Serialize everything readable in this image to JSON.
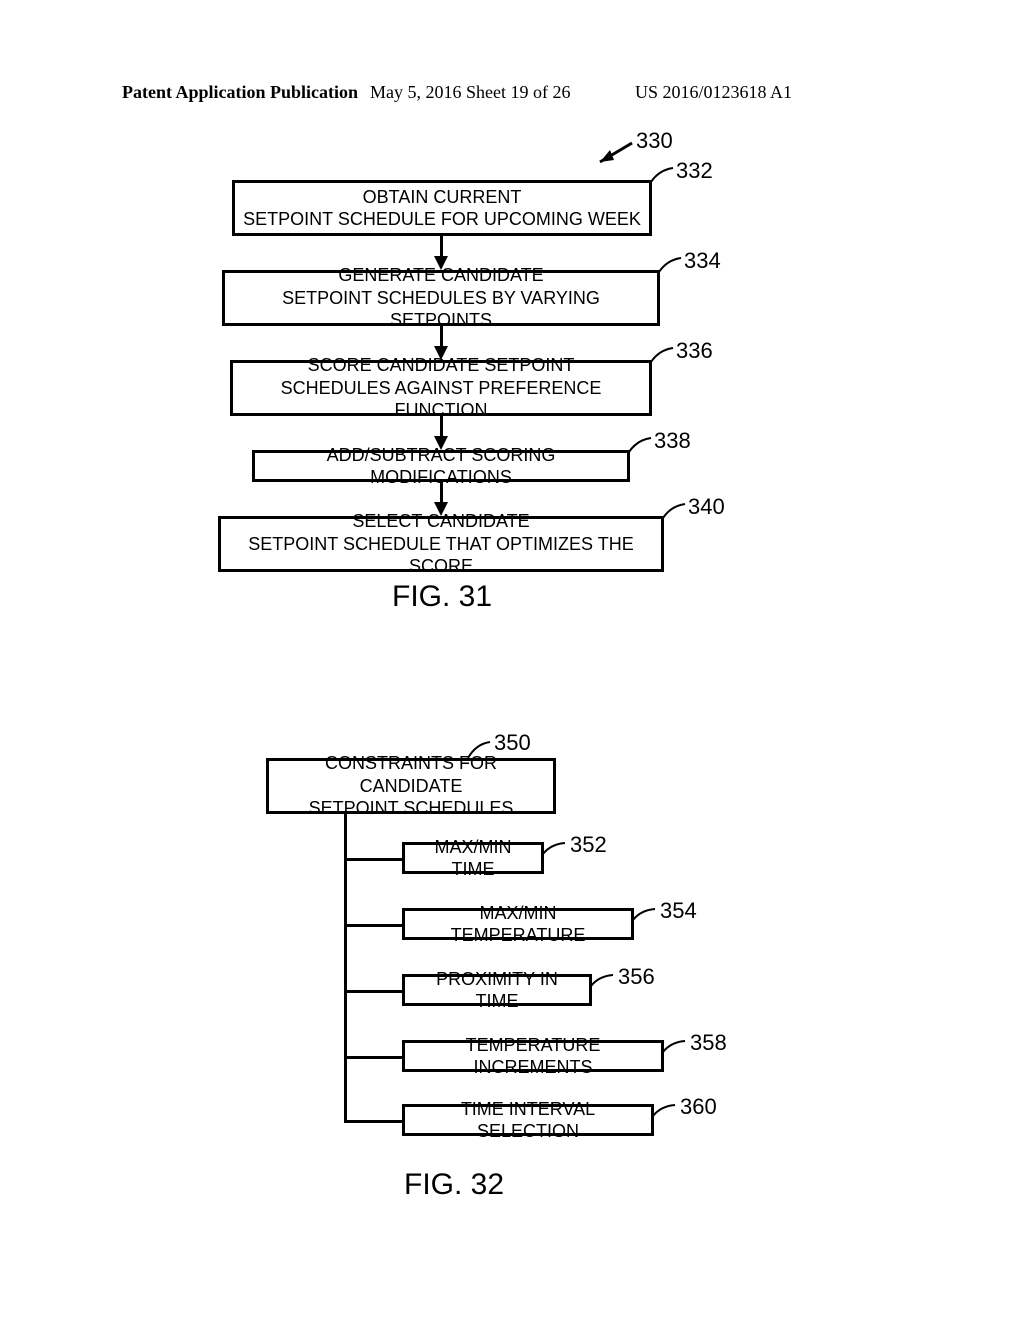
{
  "header": {
    "left": "Patent Application Publication",
    "mid": "May 5, 2016  Sheet 19 of 26",
    "right": "US 2016/0123618 A1"
  },
  "fig31": {
    "main_ref": "330",
    "caption": "FIG. 31",
    "steps": [
      {
        "ref": "332",
        "line1": "OBTAIN CURRENT",
        "line2": "SETPOINT SCHEDULE FOR UPCOMING WEEK"
      },
      {
        "ref": "334",
        "line1": "GENERATE CANDIDATE",
        "line2": "SETPOINT SCHEDULES BY VARYING SETPOINTS"
      },
      {
        "ref": "336",
        "line1": "SCORE CANDIDATE SETPOINT",
        "line2": "SCHEDULES AGAINST PREFERENCE FUNCTION"
      },
      {
        "ref": "338",
        "line1": "ADD/SUBTRACT SCORING MODIFICATIONS",
        "line2": ""
      },
      {
        "ref": "340",
        "line1": "SELECT CANDIDATE",
        "line2": "SETPOINT SCHEDULE THAT OPTIMIZES THE SCORE"
      }
    ]
  },
  "fig32": {
    "caption": "FIG. 32",
    "root": {
      "ref": "350",
      "line1": "CONSTRAINTS FOR CANDIDATE",
      "line2": "SETPOINT SCHEDULES"
    },
    "items": [
      {
        "ref": "352",
        "text": "MAX/MIN TIME"
      },
      {
        "ref": "354",
        "text": "MAX/MIN TEMPERATURE"
      },
      {
        "ref": "356",
        "text": "PROXIMITY IN TIME"
      },
      {
        "ref": "358",
        "text": "TEMPERATURE INCREMENTS"
      },
      {
        "ref": "360",
        "text": "TIME INTERVAL SELECTION"
      }
    ]
  }
}
